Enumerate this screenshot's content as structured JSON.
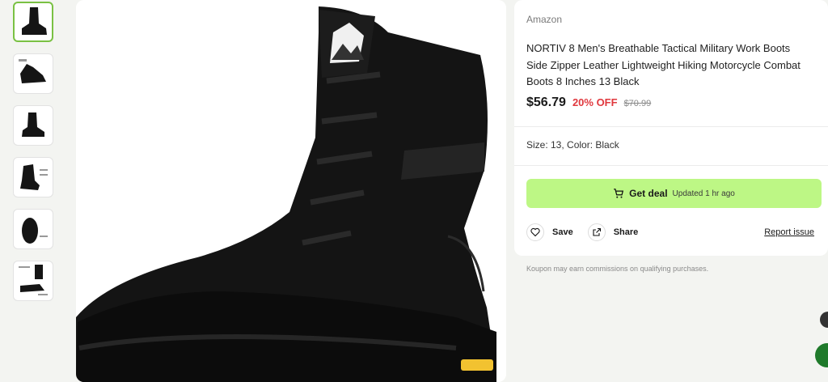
{
  "gallery": {
    "thumbnail_count": 6,
    "active_index": 0
  },
  "product": {
    "store": "Amazon",
    "title": "NORTIV 8 Men's Breathable Tactical Military Work Boots Side Zipper Leather Lightweight Hiking Motorcycle Combat Boots 8 Inches 13 Black",
    "price": "$56.79",
    "discount": "20% OFF",
    "original_price": "$70.99",
    "variant": "Size: 13, Color: Black"
  },
  "deal": {
    "button_label": "Get deal",
    "updated": "Updated 1 hr ago",
    "accent_color": "#bdf785"
  },
  "actions": {
    "save_label": "Save",
    "share_label": "Share",
    "report_label": "Report issue"
  },
  "footer": {
    "disclaimer": "Koupon may earn commissions on qualifying purchases."
  },
  "icons": [
    "cart-icon",
    "heart-icon",
    "share-icon"
  ]
}
